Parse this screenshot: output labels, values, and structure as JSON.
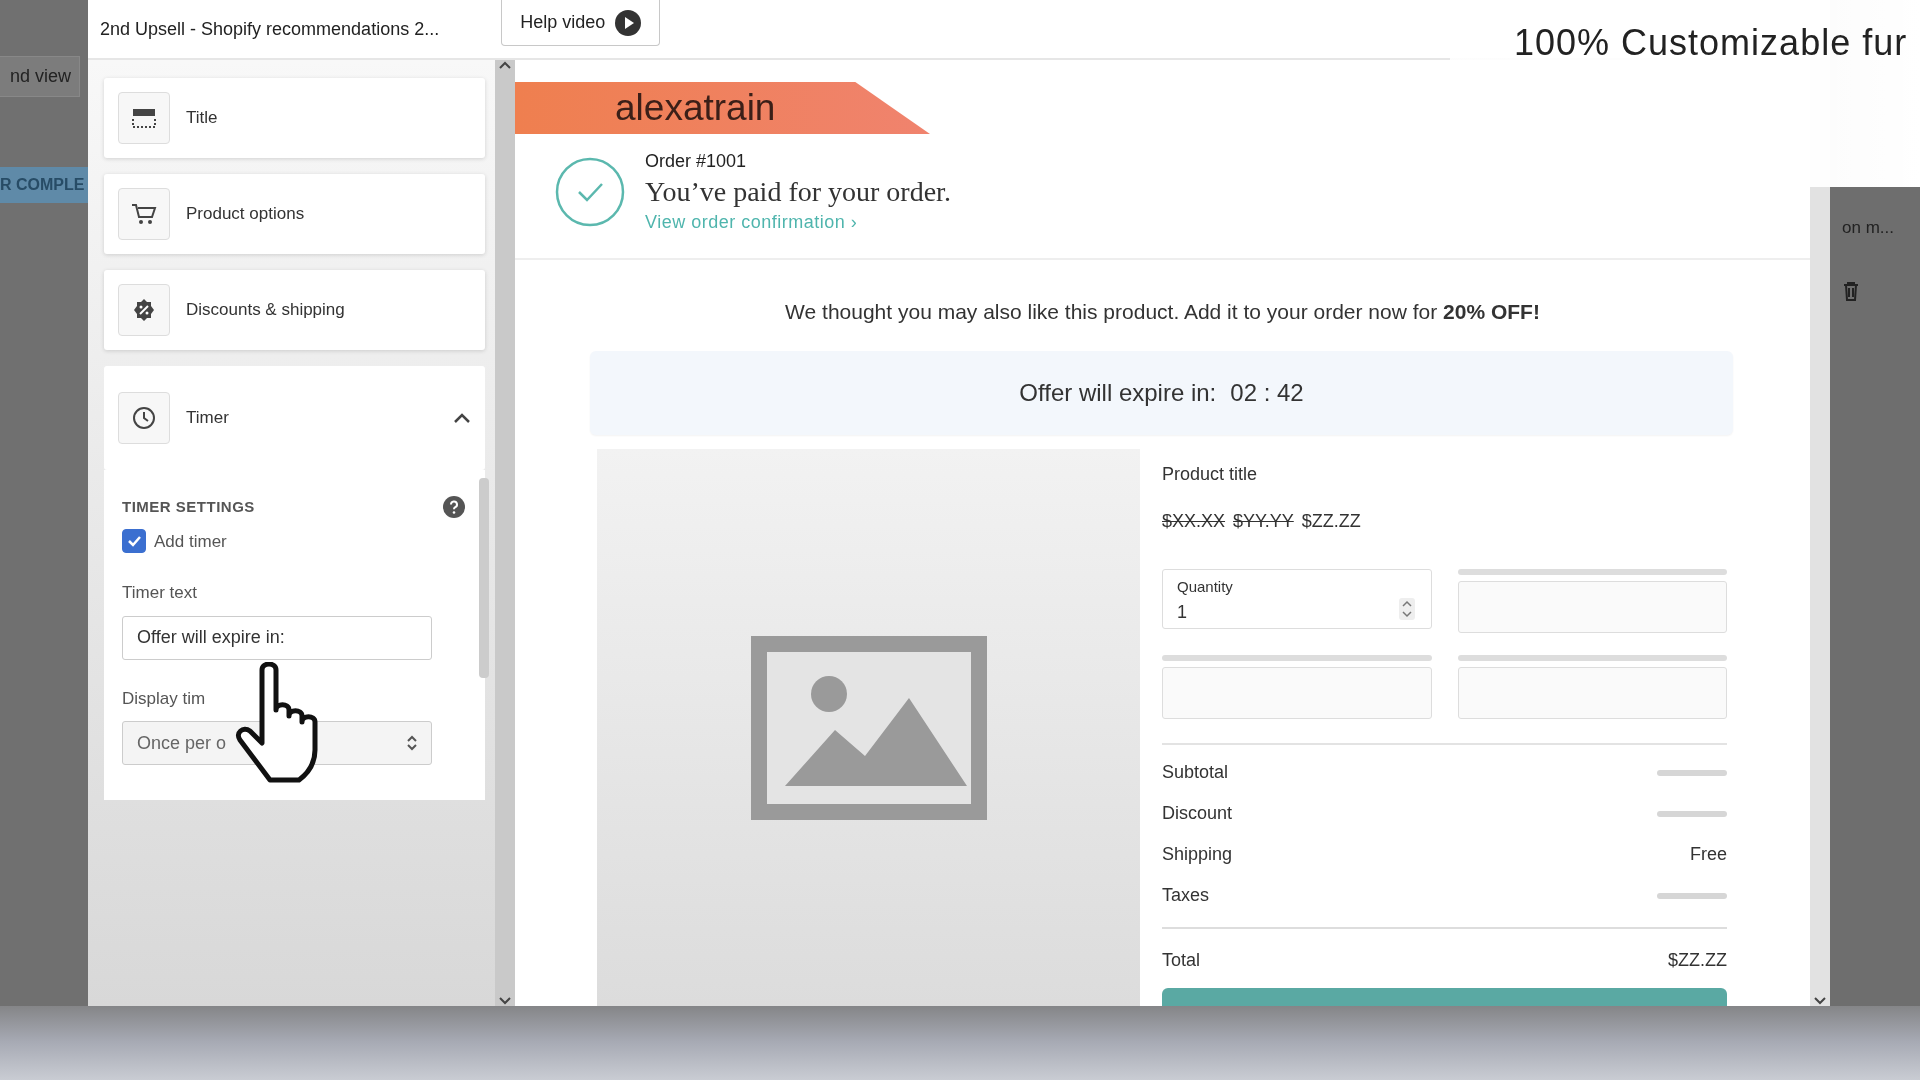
{
  "backdrop": {
    "left_button": "nd view",
    "left_tab": "R COMPLE",
    "right_dropdown": "on m..."
  },
  "overlay_caption": "100% Customizable fur",
  "editor": {
    "title": "2nd Upsell - Shopify recommendations 2...",
    "help_button": "Help video"
  },
  "sidebar": {
    "sections": [
      {
        "label": "Title",
        "expanded": false
      },
      {
        "label": "Product options",
        "expanded": false
      },
      {
        "label": "Discounts & shipping",
        "expanded": false
      },
      {
        "label": "Timer",
        "expanded": true
      }
    ],
    "timer_settings": {
      "heading": "TIMER SETTINGS",
      "add_timer": {
        "label": "Add timer",
        "checked": true
      },
      "timer_text": {
        "label": "Timer text",
        "value": "Offer will expire in:"
      },
      "display": {
        "label": "Display tim",
        "value": "Once per o"
      }
    }
  },
  "preview": {
    "store_name": "alexatrain",
    "order_number": "Order #1001",
    "paid_message": "You’ve paid for your order.",
    "confirmation_link": "View order confirmation ›",
    "offer_message": "We thought you may also like this product. Add it to your order now for **20% OFF!**",
    "timer": {
      "label": "Offer will expire in:",
      "time": "02 : 42"
    },
    "product": {
      "title": "Product title",
      "prices": [
        {
          "text": "$XX.XX",
          "struck": true
        },
        {
          "text": "$YY.YY",
          "struck": true
        },
        {
          "text": "$ZZ.ZZ",
          "struck": false
        }
      ],
      "quantity": {
        "label": "Quantity",
        "value": "1"
      },
      "summary": [
        {
          "label": "Subtotal",
          "kind": "placeholder"
        },
        {
          "label": "Discount",
          "kind": "placeholder"
        },
        {
          "label": "Shipping",
          "kind": "text",
          "value": "Free"
        },
        {
          "label": "Taxes",
          "kind": "placeholder"
        },
        {
          "label": "Total",
          "kind": "total",
          "value": "$ZZ.ZZ"
        }
      ]
    }
  }
}
